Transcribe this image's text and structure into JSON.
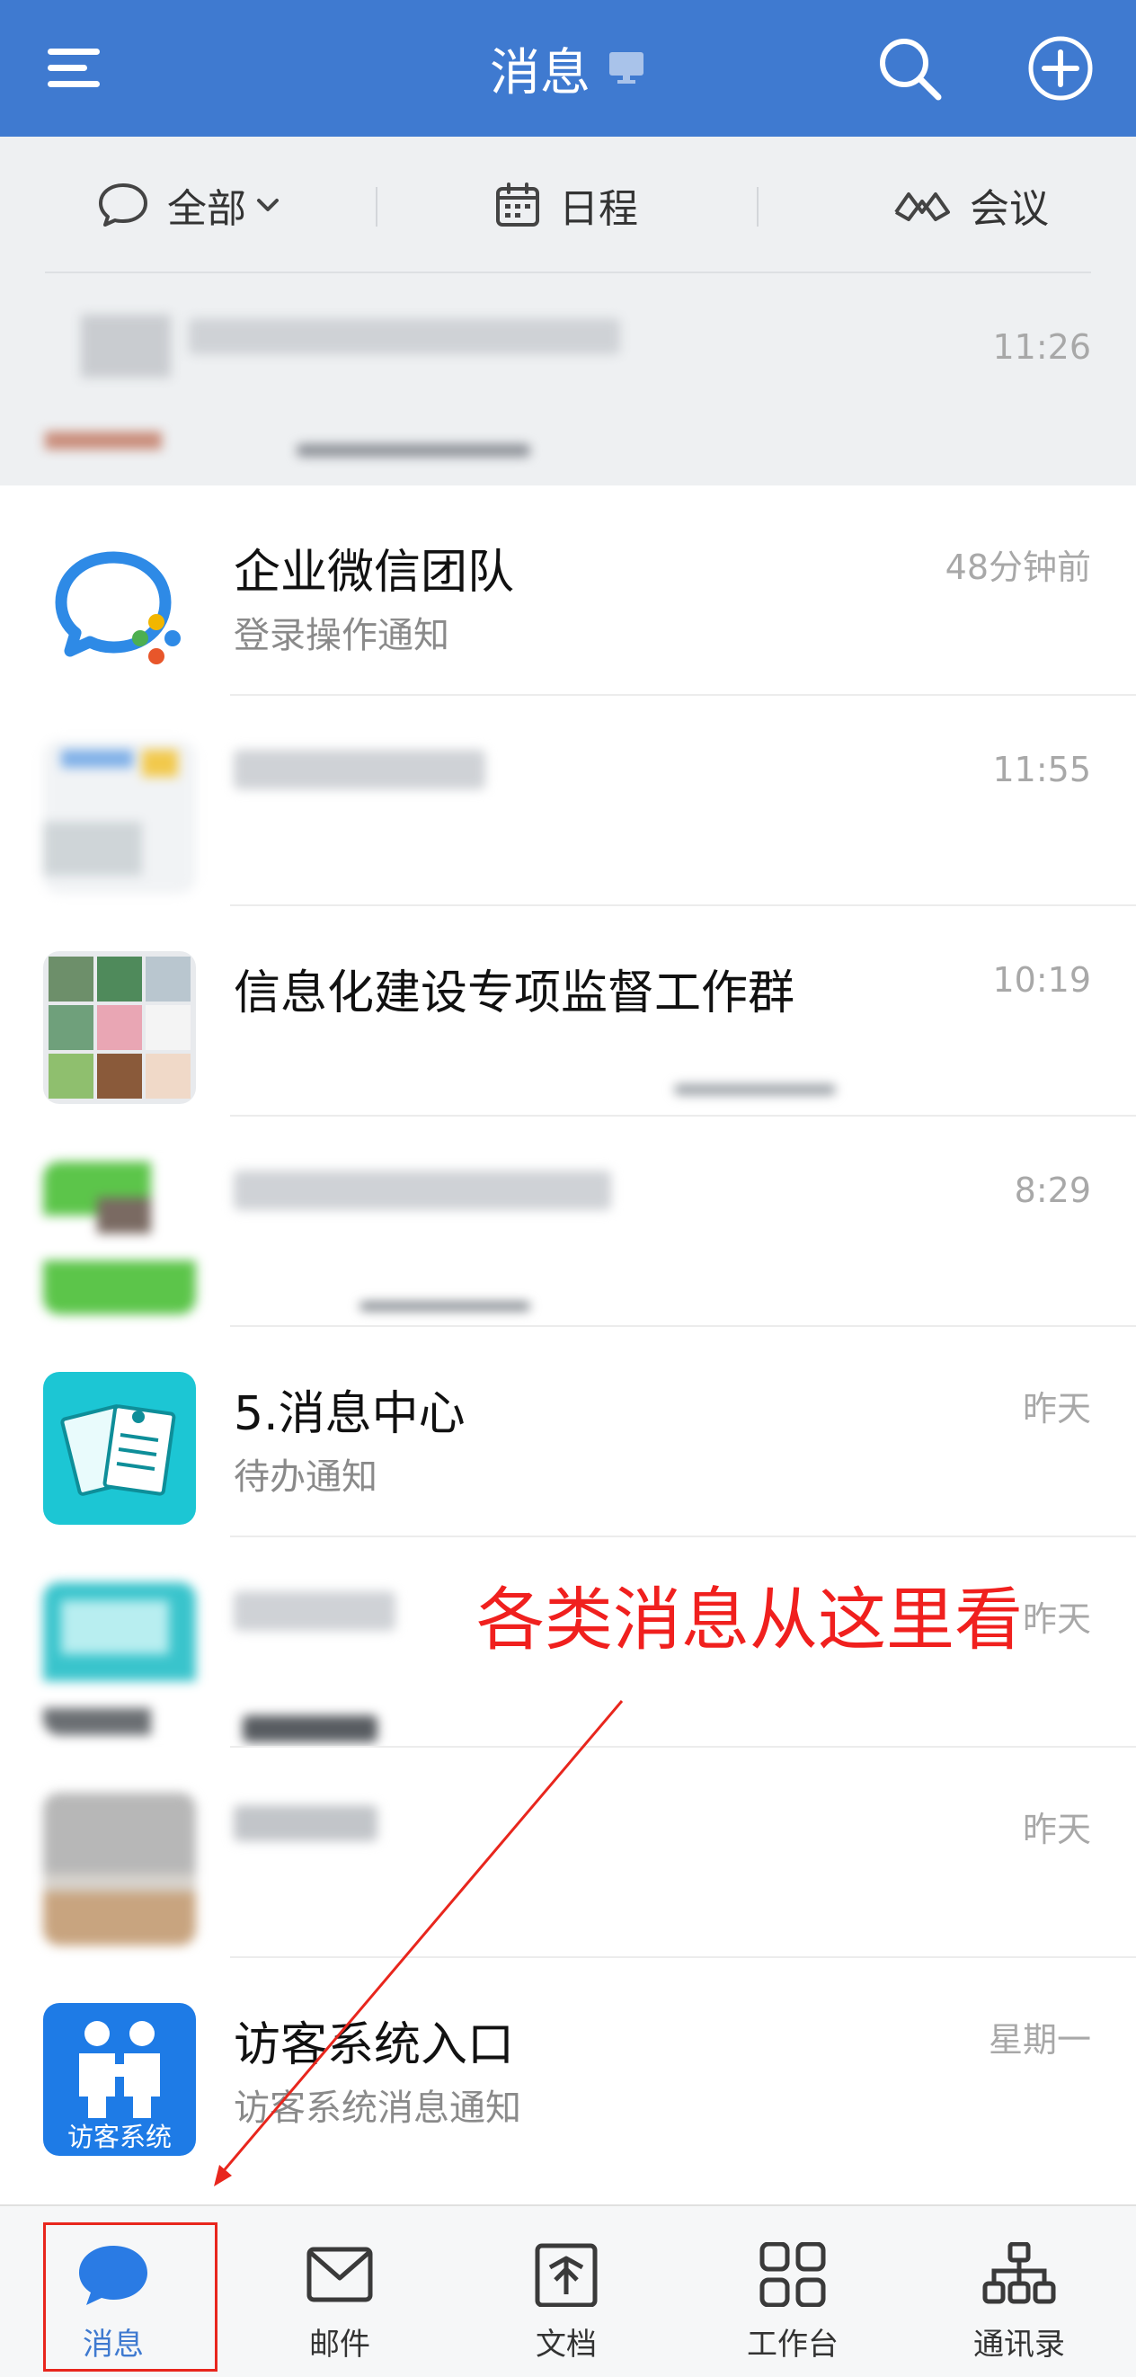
{
  "colors": {
    "header_bg": "#3f7ad0",
    "accent": "#3f7ad0",
    "annotation": "#f0201e",
    "filter_bg": "#eef0f2"
  },
  "header": {
    "title": "消息",
    "icons": [
      "menu-icon",
      "desktop-icon",
      "search-icon",
      "add-icon"
    ]
  },
  "filters": {
    "all": "全部",
    "schedule": "日程",
    "meeting": "会议"
  },
  "conversations": [
    {
      "id": "pinned-blurred",
      "title": "",
      "subtitle": "",
      "time": "11:26"
    },
    {
      "id": "wecom-team",
      "title": "企业微信团队",
      "subtitle": "登录操作通知",
      "time": "48分钟前"
    },
    {
      "id": "blurred-2",
      "title": "",
      "subtitle": "",
      "time": "11:55"
    },
    {
      "id": "info-group",
      "title": "信息化建设专项监督工作群",
      "subtitle": "",
      "time": "10:19"
    },
    {
      "id": "blurred-4",
      "title": "",
      "subtitle": "",
      "time": "8:29"
    },
    {
      "id": "msg-center",
      "title": "5.消息中心",
      "subtitle": "待办通知",
      "time": "昨天"
    },
    {
      "id": "blurred-6",
      "title": "",
      "subtitle": "",
      "time": "昨天"
    },
    {
      "id": "blurred-7",
      "title": "",
      "subtitle": "",
      "time": "昨天"
    },
    {
      "id": "visitor",
      "title": "访客系统入口",
      "subtitle": "访客系统消息通知",
      "time": "星期一",
      "avatar_text": "访客系统"
    }
  ],
  "annotation": {
    "text": "各类消息从这里看"
  },
  "bottom_nav": [
    {
      "label": "消息",
      "icon": "chat-bubble-icon",
      "active": true
    },
    {
      "label": "邮件",
      "icon": "mail-icon",
      "active": false
    },
    {
      "label": "文档",
      "icon": "document-icon",
      "active": false
    },
    {
      "label": "工作台",
      "icon": "grid-icon",
      "active": false
    },
    {
      "label": "通讯录",
      "icon": "org-chart-icon",
      "active": false
    }
  ]
}
